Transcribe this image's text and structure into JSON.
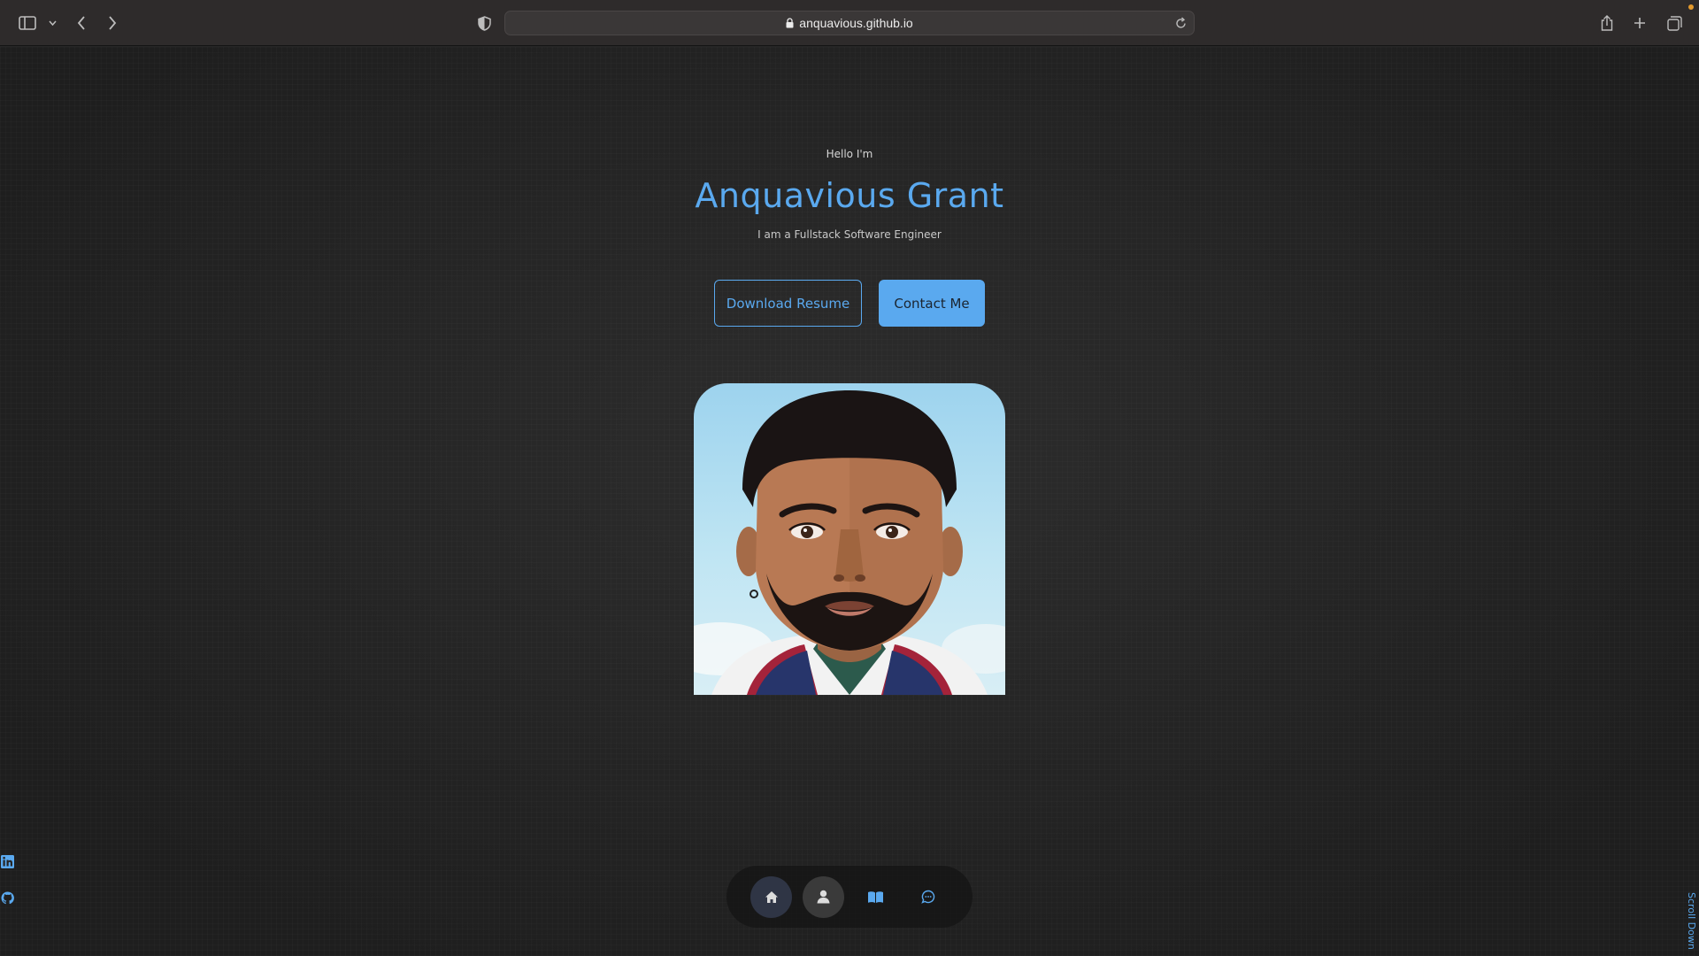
{
  "browser": {
    "url": "anquavious.github.io",
    "icons": {
      "sidebar": "sidebar-icon",
      "sidebar_menu": "chevron-down-icon",
      "back": "chevron-left-icon",
      "forward": "chevron-right-icon",
      "privacy": "shield-icon",
      "lock": "lock-icon",
      "reload": "reload-icon",
      "share": "share-icon",
      "new_tab": "plus-icon",
      "tabs": "tab-overview-icon"
    }
  },
  "hero": {
    "greeting": "Hello I'm",
    "name": "Anquavious Grant",
    "role": "I am a Fullstack Software Engineer",
    "buttons": {
      "download_resume": "Download Resume",
      "contact_me": "Contact Me"
    }
  },
  "colors": {
    "accent": "#5aa9ef",
    "background": "#252525",
    "chrome": "#2e2b2b"
  },
  "nav": {
    "items": [
      {
        "icon": "home-icon"
      },
      {
        "icon": "user-icon"
      },
      {
        "icon": "book-icon"
      },
      {
        "icon": "chat-icon"
      }
    ]
  },
  "socials": {
    "items": [
      {
        "icon": "linkedin-icon"
      },
      {
        "icon": "github-icon"
      }
    ]
  },
  "scroll": {
    "label": "Scroll Down"
  }
}
